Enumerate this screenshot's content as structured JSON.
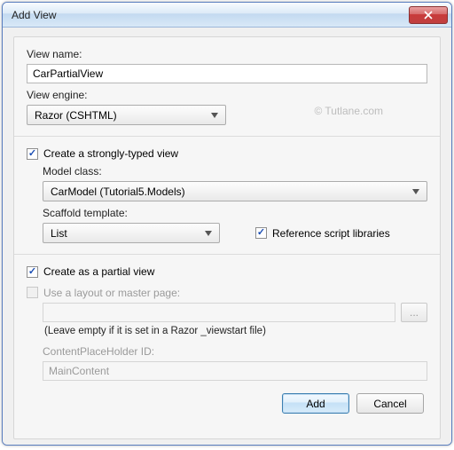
{
  "window": {
    "title": "Add View"
  },
  "watermark": "© Tutlane.com",
  "labels": {
    "view_name": "View name:",
    "view_engine": "View engine:",
    "strongly_typed": "Create a strongly-typed view",
    "model_class": "Model class:",
    "scaffold_template": "Scaffold template:",
    "ref_scripts": "Reference script libraries",
    "partial_view": "Create as a partial view",
    "use_layout": "Use a layout or master page:",
    "layout_hint": "(Leave empty if it is set in a Razor _viewstart file)",
    "cph_id": "ContentPlaceHolder ID:"
  },
  "fields": {
    "view_name": "CarPartialView",
    "view_engine": "Razor (CSHTML)",
    "model_class": "CarModel (Tutorial5.Models)",
    "scaffold_template": "List",
    "layout_path": "",
    "cph_value": "MainContent"
  },
  "checks": {
    "strongly_typed": true,
    "ref_scripts": true,
    "partial_view": true,
    "use_layout": false
  },
  "buttons": {
    "browse": "...",
    "add": "Add",
    "cancel": "Cancel"
  }
}
